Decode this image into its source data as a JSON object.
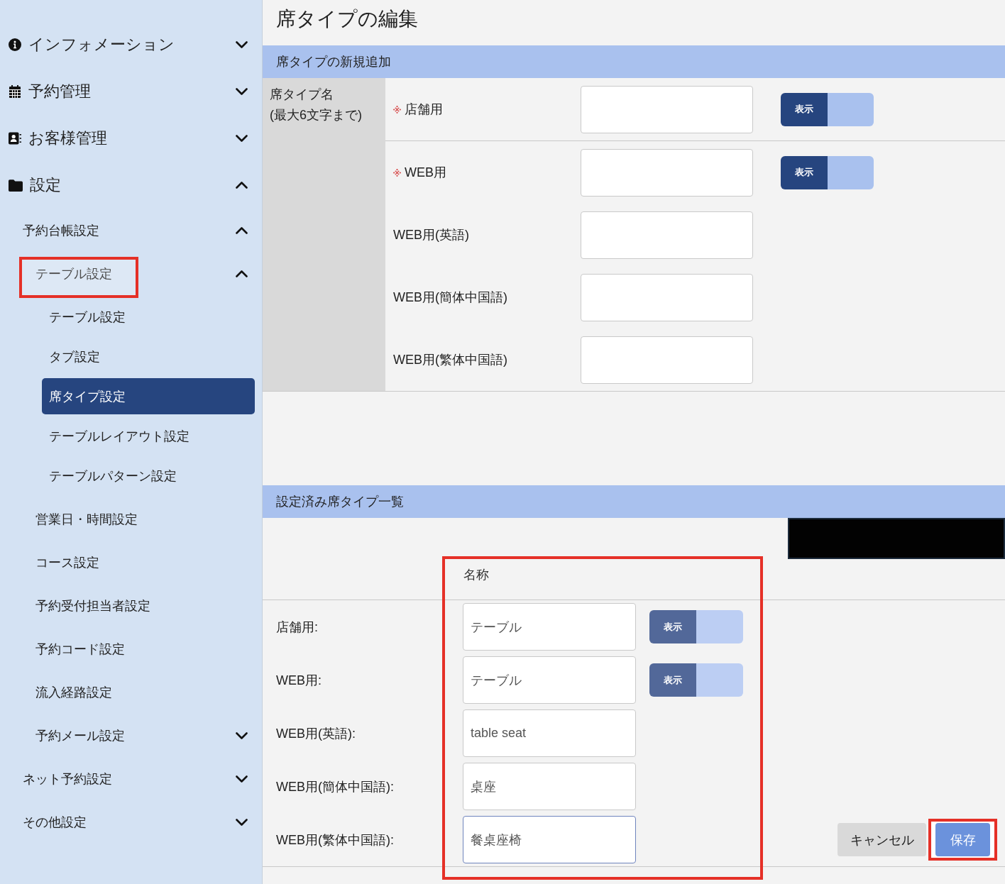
{
  "sidebar": {
    "items": [
      {
        "label": "インフォメーション",
        "selected": false,
        "expanded": false
      },
      {
        "label": "予約管理",
        "selected": false,
        "expanded": false
      },
      {
        "label": "お客様管理",
        "selected": false,
        "expanded": false
      },
      {
        "label": "設定",
        "selected": false,
        "expanded": true,
        "children": [
          {
            "label": "予約台帳設定",
            "selected": false,
            "expanded": true,
            "children": [
              {
                "label": "テーブル設定",
                "selected": false,
                "expanded": true,
                "highlighted": true,
                "children": [
                  {
                    "label": "テーブル設定",
                    "selected": false
                  },
                  {
                    "label": "タブ設定",
                    "selected": false
                  },
                  {
                    "label": "席タイプ設定",
                    "selected": true
                  },
                  {
                    "label": "テーブルレイアウト設定",
                    "selected": false
                  },
                  {
                    "label": "テーブルパターン設定",
                    "selected": false
                  }
                ]
              },
              {
                "label": "営業日・時間設定",
                "selected": false,
                "highlighted": false
              },
              {
                "label": "コース設定",
                "selected": false,
                "highlighted": false
              },
              {
                "label": "予約受付担当者設定",
                "selected": false,
                "highlighted": false
              },
              {
                "label": "予約コード設定",
                "selected": false,
                "highlighted": false
              },
              {
                "label": "流入経路設定",
                "selected": false,
                "highlighted": false
              },
              {
                "label": "予約メール設定",
                "selected": false,
                "expanded": false,
                "highlighted": false
              }
            ]
          },
          {
            "label": "ネット予約設定",
            "selected": false,
            "expanded": false
          },
          {
            "label": "その他設定",
            "selected": false,
            "expanded": false
          }
        ]
      }
    ]
  },
  "page_title": "席タイプの編集",
  "new_section": {
    "title": "席タイプの新規追加",
    "group_label": "席タイプ名",
    "group_note": "(最大6文字まで)",
    "field_groups": [
      {
        "fields": [
          {
            "label": "店舗用",
            "required": true,
            "toggle": {
              "label": "表示",
              "on": true,
              "disabled": false
            }
          }
        ]
      },
      {
        "fields": [
          {
            "label": "WEB用",
            "required": true,
            "toggle": {
              "label": "表示",
              "on": true,
              "disabled": false
            }
          },
          {
            "label": "WEB用(英語)",
            "required": false
          },
          {
            "label": "WEB用(簡体中国語)",
            "required": false
          },
          {
            "label": "WEB用(繁体中国語)",
            "required": false
          }
        ]
      }
    ]
  },
  "list_section": {
    "title": "設定済み席タイプ一覧",
    "column_header": {
      "label": "名称",
      "highlighted": true
    },
    "rows": [
      {
        "label": "店舗用:",
        "value": "テーブル",
        "focused": false,
        "toggle": {
          "label": "表示",
          "on": true,
          "disabled": true
        }
      },
      {
        "label": "WEB用:",
        "value": "テーブル",
        "focused": false,
        "toggle": {
          "label": "表示",
          "on": true,
          "disabled": true
        }
      },
      {
        "label": "WEB用(英語):",
        "value": "table seat",
        "focused": false
      },
      {
        "label": "WEB用(簡体中国語):",
        "value": "桌座",
        "focused": false
      },
      {
        "label": "WEB用(繁体中国語):",
        "value": "餐桌座椅",
        "focused": true
      }
    ]
  },
  "buttons": [
    {
      "label": "キャンセル",
      "kind": "secondary",
      "highlighted": false
    },
    {
      "label": "保存",
      "kind": "primary",
      "highlighted": true
    }
  ]
}
